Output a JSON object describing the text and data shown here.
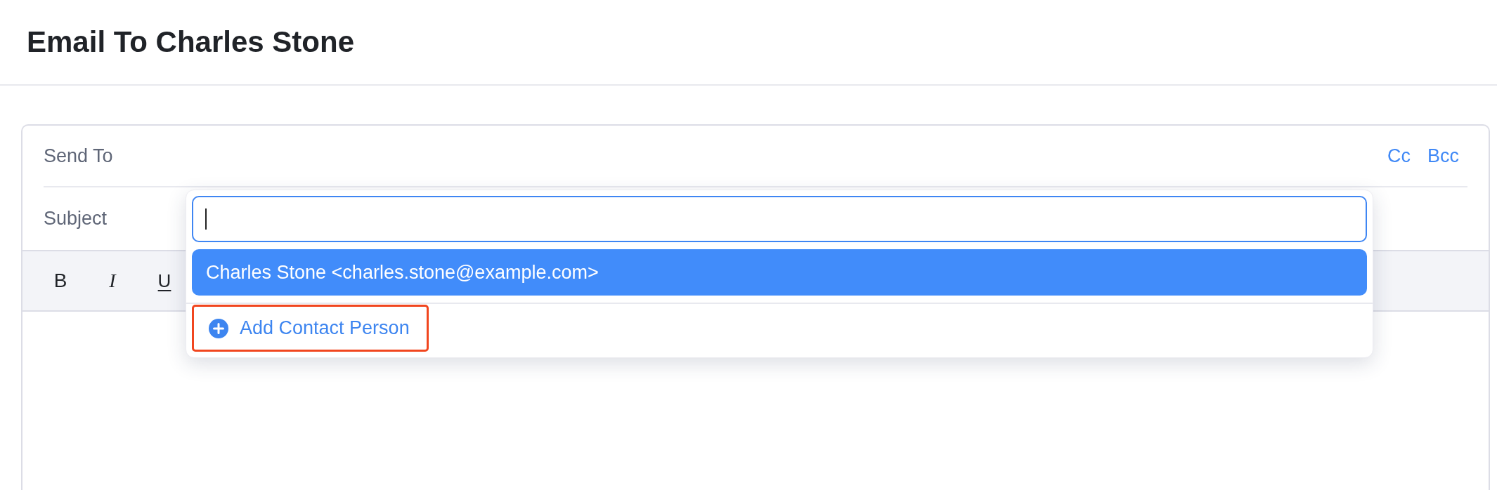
{
  "page": {
    "title": "Email To Charles Stone"
  },
  "form": {
    "send_to": {
      "label": "Send To"
    },
    "copy_links": [
      {
        "label": "Cc"
      },
      {
        "label": "Bcc"
      }
    ],
    "subject": {
      "label": "Subject"
    }
  },
  "toolbar": [
    {
      "kind": "bold",
      "label": "B"
    },
    {
      "kind": "italic",
      "label": "I"
    },
    {
      "kind": "underline",
      "label": "U"
    }
  ],
  "recipient_dropdown": {
    "search": {
      "focused": true
    },
    "options": [
      {
        "label": "Charles Stone <charles.stone@example.com>",
        "selected": true
      }
    ],
    "add_contact": {
      "label": "Add Contact Person",
      "highlighted": true
    }
  }
}
